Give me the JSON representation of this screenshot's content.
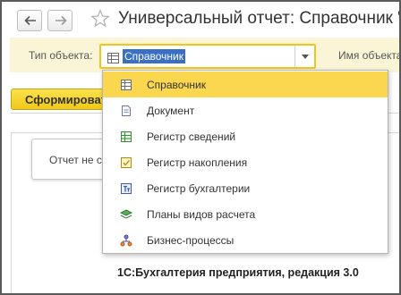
{
  "window": {
    "title": "Универсальный отчет: Справочник \"Контрагенты\"",
    "icons": {
      "back": "arrow-left-icon",
      "forward": "arrow-right-icon",
      "favorite": "star-icon"
    }
  },
  "filter": {
    "object_type_label": "Тип объекта:",
    "object_type_value": "Справочник",
    "object_name_label": "Имя объекта:"
  },
  "toolbar": {
    "generate_label": "Сформировать"
  },
  "report": {
    "message": "Отчет не сформирован."
  },
  "dropdown": {
    "items": [
      {
        "label": "Справочник",
        "icon": "catalog-icon",
        "selected": true
      },
      {
        "label": "Документ",
        "icon": "document-icon",
        "selected": false
      },
      {
        "label": "Регистр сведений",
        "icon": "information-register-icon",
        "selected": false
      },
      {
        "label": "Регистр накопления",
        "icon": "accumulation-register-icon",
        "selected": false
      },
      {
        "label": "Регистр бухгалтерии",
        "icon": "accounting-register-icon",
        "selected": false
      },
      {
        "label": "Планы видов расчета",
        "icon": "calculation-types-icon",
        "selected": false
      },
      {
        "label": "Бизнес-процессы",
        "icon": "business-process-icon",
        "selected": false
      }
    ]
  },
  "footer": {
    "caption": "1С:Бухгалтерия предприятия, редакция 3.0"
  },
  "colors": {
    "accent_yellow": "#f2c51c",
    "selection_blue": "#3a6fc5",
    "highlight_row": "#fbd64f",
    "filter_bg": "#fbf5d7"
  }
}
